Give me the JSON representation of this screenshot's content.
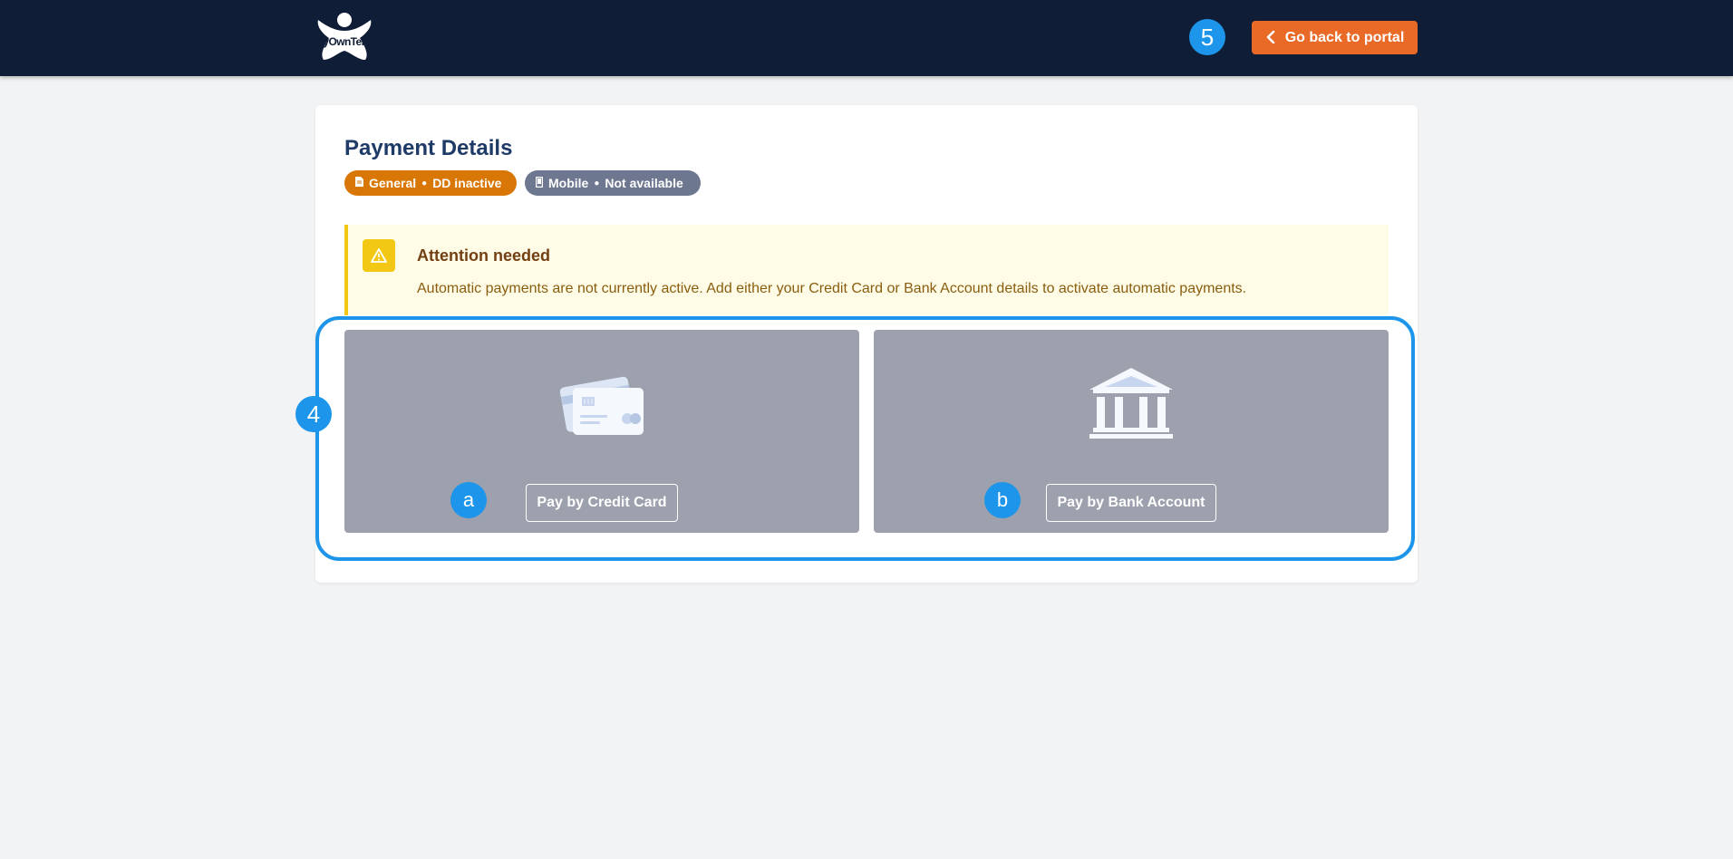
{
  "header": {
    "logo_text": "MyOwnTel",
    "back_button_label": "Go back to portal",
    "back_icon": "chevron-left-icon",
    "annotation_label": "5"
  },
  "page": {
    "title": "Payment Details",
    "pills": [
      {
        "icon": "document-icon",
        "category": "General",
        "status": "DD inactive",
        "color": "#d97706"
      },
      {
        "icon": "mobile-icon",
        "category": "Mobile",
        "status": "Not available",
        "color": "#6e7790"
      }
    ],
    "alert": {
      "icon": "warning-icon",
      "title": "Attention needed",
      "message": "Automatic payments are not currently active. Add either your Credit Card or Bank Account details to activate automatic payments."
    },
    "options_annotation_label": "4",
    "options": [
      {
        "icon": "credit-card-icon",
        "label": "Pay by Credit Card",
        "annotation": "a"
      },
      {
        "icon": "bank-icon",
        "label": "Pay by Bank Account",
        "annotation": "b"
      }
    ]
  },
  "colors": {
    "header_bg": "#0f1d36",
    "accent": "#e96a27",
    "annotation": "#1d95eb",
    "title": "#1e3a66",
    "tile_bg": "#9ca1ad",
    "alert_bg": "#fefce6",
    "alert_border": "#f3c814"
  }
}
